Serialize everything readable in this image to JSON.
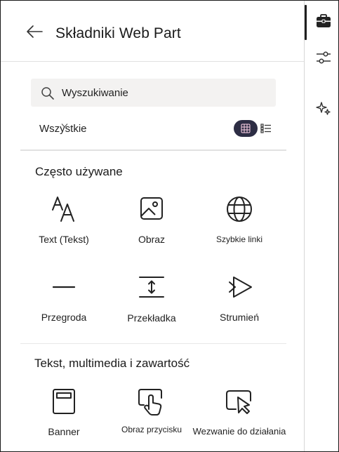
{
  "header": {
    "title": "Składniki Web Part"
  },
  "search": {
    "placeholder": "Wyszukiwanie"
  },
  "filter": {
    "label": "Wszystkie"
  },
  "sections": {
    "frequent": {
      "title": "Często używane",
      "items": [
        {
          "label": "Text (Tekst)",
          "icon": "text-icon"
        },
        {
          "label": "Obraz",
          "icon": "image-icon"
        },
        {
          "label": "Szybkie linki",
          "icon": "globe-icon"
        },
        {
          "label": "Przegroda",
          "icon": "divider-icon"
        },
        {
          "label": "Przekładka",
          "icon": "spacer-icon"
        },
        {
          "label": "Strumień",
          "icon": "stream-icon"
        }
      ]
    },
    "media": {
      "title": "Tekst, multimedia i zawartość",
      "items": [
        {
          "label": "Banner",
          "icon": "banner-icon"
        },
        {
          "label": "Obraz przycisku",
          "icon": "image-button-icon"
        },
        {
          "label": "Wezwanie do działania",
          "icon": "call-to-action-icon"
        }
      ]
    }
  },
  "rail": {
    "icons": [
      "toolbox-icon",
      "settings-sliders-icon",
      "sparkle-icon"
    ]
  },
  "colors": {
    "accent_toggle": "#2d2d44",
    "search_bg": "#f3f2f1",
    "divider": "#e1e1e1"
  }
}
